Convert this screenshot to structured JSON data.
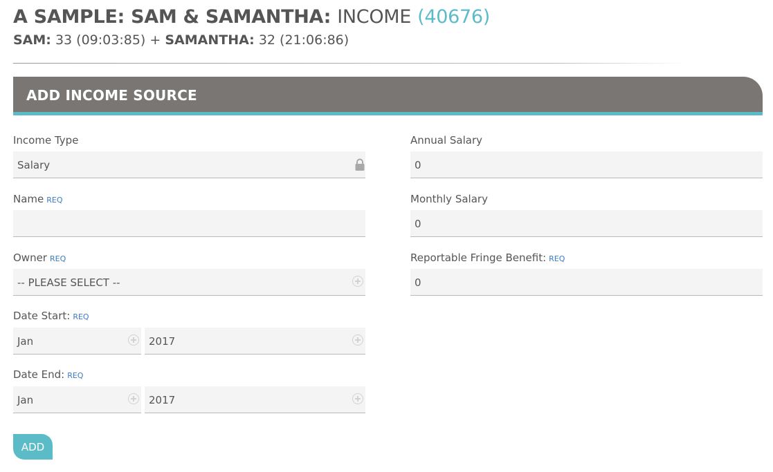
{
  "page": {
    "title_bold": "A SAMPLE: SAM & SAMANTHA:",
    "title_light": "INCOME",
    "title_id": "(40676)",
    "person1_name": "SAM:",
    "person1_detail": "33 (09:03:85)",
    "plus": "+",
    "person2_name": "SAMANTHA:",
    "person2_detail": "32 (21:06:86)"
  },
  "panel": {
    "header": "ADD INCOME SOURCE"
  },
  "form": {
    "req": "REQ",
    "income_type": {
      "label": "Income Type",
      "value": "Salary"
    },
    "name": {
      "label": "Name",
      "value": ""
    },
    "owner": {
      "label": "Owner",
      "value": "-- PLEASE SELECT --"
    },
    "date_start": {
      "label": "Date Start:",
      "month": "Jan",
      "year": "2017"
    },
    "date_end": {
      "label": "Date End:",
      "month": "Jan",
      "year": "2017"
    },
    "annual_salary": {
      "label": "Annual Salary",
      "value": "0"
    },
    "monthly_salary": {
      "label": "Monthly Salary",
      "value": "0"
    },
    "fringe_benefit": {
      "label": "Reportable Fringe Benefit:",
      "value": "0"
    },
    "add_label": "ADD"
  },
  "icons": {
    "income_type_icon": "lock-icon",
    "select_icon": "plus-circle-icon"
  },
  "colors": {
    "accent": "#5bbcc7",
    "header_bg": "#797674",
    "req": "#3b7bbf",
    "field_bg": "#f4f4f4"
  }
}
